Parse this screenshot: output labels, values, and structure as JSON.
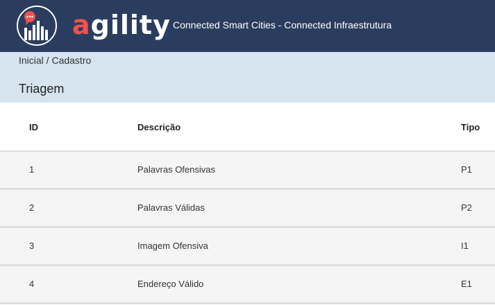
{
  "header": {
    "brand": {
      "accent": "a",
      "rest": "gility"
    },
    "title": "Connected Smart Cities - Connected Infraestrutura",
    "background": "#2b3d5e",
    "accent_color": "#f0524f",
    "logo_icon": "chat-bar-chart-icon"
  },
  "subheader": {
    "breadcrumb": "Inicial / Cadastro",
    "page_title": "Triagem",
    "background": "#d5e4ee"
  },
  "table": {
    "columns": [
      "ID",
      "Descrição",
      "Tipo"
    ],
    "rows": [
      {
        "id": "1",
        "descricao": "Palavras Ofensivas",
        "tipo": "P1"
      },
      {
        "id": "2",
        "descricao": "Palavras Válidas",
        "tipo": "P2"
      },
      {
        "id": "3",
        "descricao": "Imagem Ofensiva",
        "tipo": "I1"
      },
      {
        "id": "4",
        "descricao": "Endereço Válido",
        "tipo": "E1"
      }
    ]
  }
}
